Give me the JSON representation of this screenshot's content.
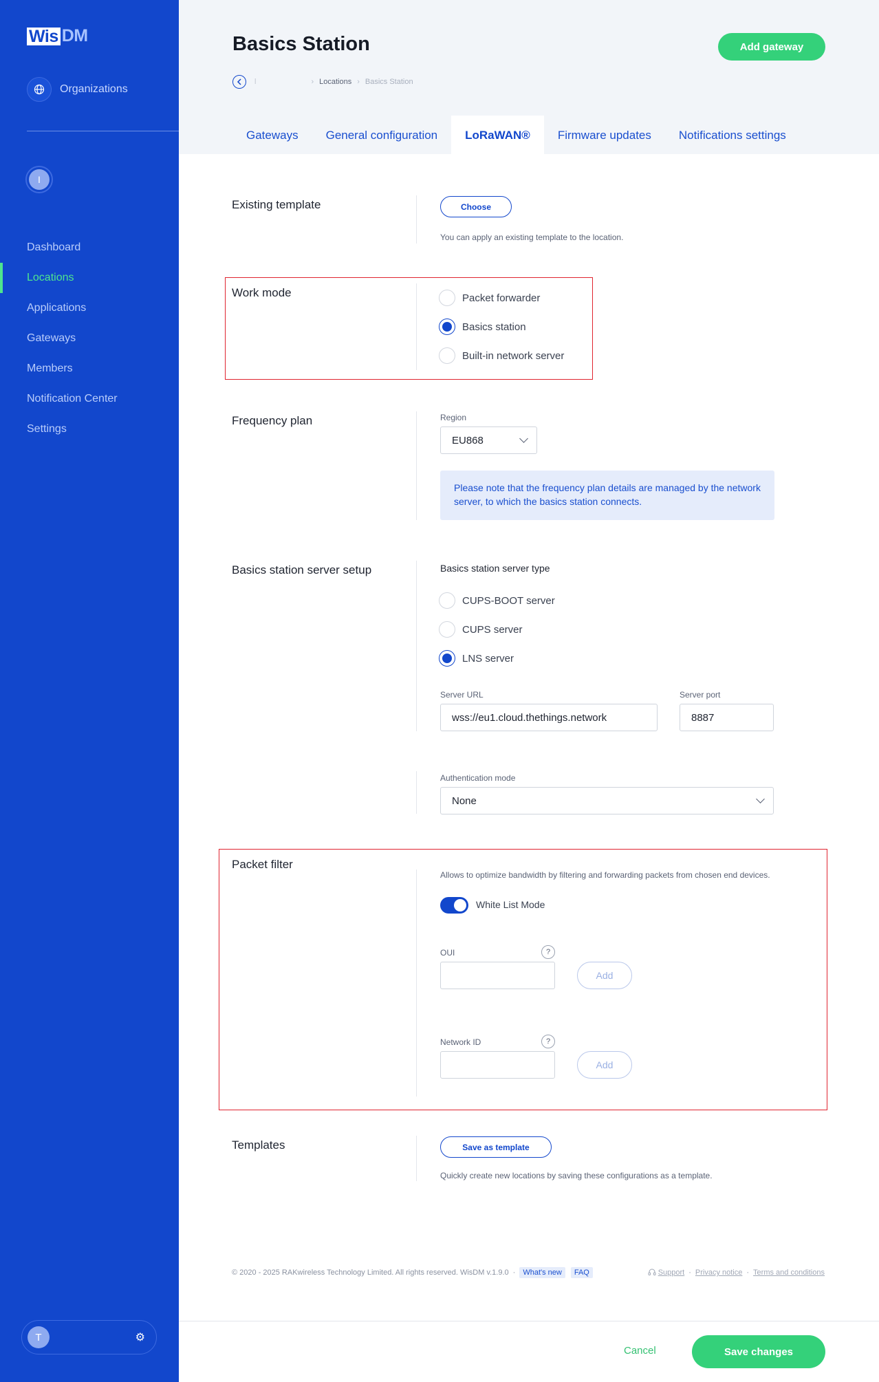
{
  "sidebar": {
    "logo_wis": "Wis",
    "logo_dm": "DM",
    "org_label": "Organizations",
    "user_initial": "I",
    "bottom_user_initial": "T",
    "items": [
      {
        "label": "Dashboard",
        "active": false
      },
      {
        "label": "Locations",
        "active": true
      },
      {
        "label": "Applications",
        "active": false
      },
      {
        "label": "Gateways",
        "active": false
      },
      {
        "label": "Members",
        "active": false
      },
      {
        "label": "Notification Center",
        "active": false
      },
      {
        "label": "Settings",
        "active": false
      }
    ]
  },
  "header": {
    "title": "Basics Station",
    "add_gateway": "Add gateway",
    "breadcrumb": {
      "first": "l",
      "second": "Locations",
      "current": "Basics Station"
    },
    "tabs": [
      "Gateways",
      "General configuration",
      "LoRaWAN®",
      "Firmware updates",
      "Notifications settings"
    ],
    "active_tab": "LoRaWAN®"
  },
  "existing_template": {
    "label": "Existing template",
    "button": "Choose",
    "hint": "You can apply an existing template to the location."
  },
  "work_mode": {
    "label": "Work mode",
    "options": [
      "Packet forwarder",
      "Basics station",
      "Built-in network server"
    ],
    "selected": "Basics station"
  },
  "frequency_plan": {
    "label": "Frequency plan",
    "region_label": "Region",
    "region_value": "EU868",
    "note": "Please note that the frequency plan details are managed by the network server, to which the basics station connects."
  },
  "server_setup": {
    "label": "Basics station server setup",
    "type_label": "Basics station server type",
    "options": [
      "CUPS-BOOT server",
      "CUPS server",
      "LNS server"
    ],
    "selected": "LNS server",
    "url_label": "Server URL",
    "url_value": "wss://eu1.cloud.thethings.network",
    "port_label": "Server port",
    "port_value": "8887",
    "auth_label": "Authentication mode",
    "auth_value": "None"
  },
  "packet_filter": {
    "label": "Packet filter",
    "hint": "Allows to optimize bandwidth by filtering and forwarding packets from chosen end devices.",
    "toggle_label": "White List Mode",
    "toggle_on": true,
    "oui_label": "OUI",
    "network_id_label": "Network ID",
    "help": "?",
    "add_label": "Add"
  },
  "templates": {
    "label": "Templates",
    "button": "Save as template",
    "hint": "Quickly create new locations by saving these configurations as a template."
  },
  "footer": {
    "copyright": "© 2020 - 2025 RAKwireless Technology Limited. All rights reserved. WisDM v.1.9.0",
    "sep": "·",
    "whats_new": "What's new",
    "faq": "FAQ",
    "support": "Support",
    "privacy": "Privacy notice",
    "terms": "Terms and conditions"
  },
  "actions": {
    "cancel": "Cancel",
    "save": "Save changes"
  },
  "colors": {
    "sidebar_bg": "#1247cc",
    "accent_green": "#34d17a",
    "highlight_red": "#e0242f"
  }
}
